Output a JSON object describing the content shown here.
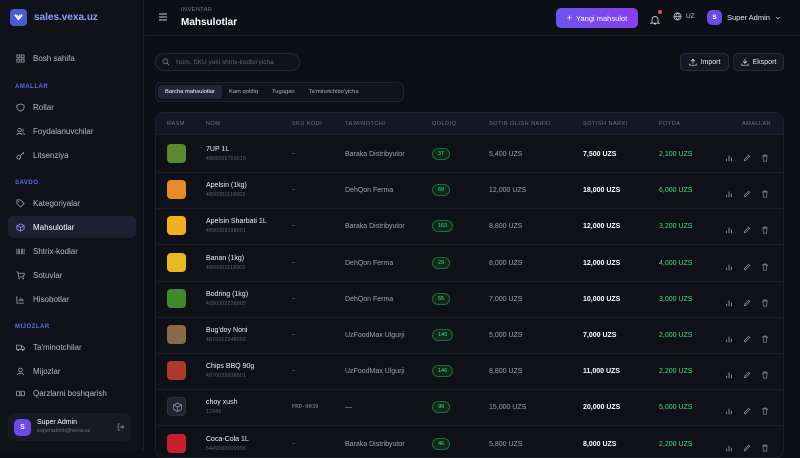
{
  "brand": {
    "name": "sales.vexa.uz"
  },
  "sidebar": {
    "items_top": [
      {
        "label": "Bosh sahifa",
        "icon": "grid-icon"
      }
    ],
    "sections": [
      {
        "title": "AMALLAR",
        "items": [
          {
            "label": "Rollar",
            "icon": "shield-icon"
          },
          {
            "label": "Foydalanuvchilar",
            "icon": "users-icon"
          },
          {
            "label": "Litsenziya",
            "icon": "key-icon"
          }
        ]
      },
      {
        "title": "SAVDO",
        "items": [
          {
            "label": "Kategoriyalar",
            "icon": "tag-icon"
          },
          {
            "label": "Mahsulotlar",
            "icon": "box-icon",
            "active": true
          },
          {
            "label": "Shtrix-kodlar",
            "icon": "barcode-icon"
          },
          {
            "label": "Sotuvlar",
            "icon": "cart-icon"
          },
          {
            "label": "Hisobotlar",
            "icon": "chart-icon"
          }
        ]
      },
      {
        "title": "MIJOZLAR",
        "items": [
          {
            "label": "Ta'minotchilar",
            "icon": "truck-icon"
          },
          {
            "label": "Mijozlar",
            "icon": "user-icon"
          },
          {
            "label": "Qarzlarni boshqarish",
            "icon": "money-icon"
          }
        ]
      }
    ],
    "user": {
      "initial": "S",
      "name": "Super Admin",
      "email": "superadmin@vexa.uz"
    }
  },
  "header": {
    "breadcrumb": "INVENTAR",
    "title": "Mahsulotlar",
    "new_button": "Yangi mahsulot",
    "lang": "UZ",
    "user_initial": "S",
    "user_name": "Super Admin"
  },
  "toolbar": {
    "search_placeholder": "Nom, SKU yoki shtrix-kodbo'yicha",
    "import_label": "Import",
    "export_label": "Eksport"
  },
  "tabs": [
    "Barcha mahsulotlar",
    "Kam qoldiq",
    "Tugagan",
    "Ta'minotchibo'yicha"
  ],
  "table": {
    "columns": [
      "RASM",
      "NOM",
      "SKU KODI",
      "TA'MINOTCHI",
      "QOLDIQ",
      "SOTIB OLISH NARXI",
      "SOTISH NARXI",
      "FOYDA",
      "AMALLAR"
    ],
    "rows": [
      {
        "name": "7UP 1L",
        "code": "4868096700015",
        "sku": "—",
        "supplier": "Baraka Distribyutor",
        "qty": "37",
        "buy": "5,400 UZS",
        "sell": "7,500 UZS",
        "profit": "2,100 UZS",
        "thumb": "#5a8a2a"
      },
      {
        "name": "Apelsin (1kg)",
        "code": "4890001118003",
        "sku": "—",
        "supplier": "DehQon Ferma",
        "qty": "69",
        "buy": "12,000 UZS",
        "sell": "18,000 UZS",
        "profit": "6,000 UZS",
        "thumb": "#e8892a"
      },
      {
        "name": "Apelsin Sharbati 1L",
        "code": "4890008298001",
        "sku": "—",
        "supplier": "Baraka Distribyutor",
        "qty": "163",
        "buy": "8,800 UZS",
        "sell": "12,000 UZS",
        "profit": "3,200 UZS",
        "thumb": "#f0b020"
      },
      {
        "name": "Banan (1kg)",
        "code": "4890001118002",
        "sku": "—",
        "supplier": "DehQon Ferma",
        "qty": "29",
        "buy": "8,000 UZS",
        "sell": "12,000 UZS",
        "profit": "4,000 UZS",
        "thumb": "#e8b820"
      },
      {
        "name": "Bodring (1kg)",
        "code": "4890002228005",
        "sku": "—",
        "supplier": "DehQon Ferma",
        "qty": "55",
        "buy": "7,000 UZS",
        "sell": "10,000 UZS",
        "profit": "3,000 UZS",
        "thumb": "#3f8a2a"
      },
      {
        "name": "Bug'doy Noni",
        "code": "4870012348002",
        "sku": "—",
        "supplier": "UzFoodMax Ulgurji",
        "qty": "146",
        "buy": "5,000 UZS",
        "sell": "7,000 UZS",
        "profit": "2,000 UZS",
        "thumb": "#8a6a4a"
      },
      {
        "name": "Chips BBQ 90g",
        "code": "4870035038001",
        "sku": "—",
        "supplier": "UzFoodMax Ulgurji",
        "qty": "146",
        "buy": "8,800 UZS",
        "sell": "11,000 UZS",
        "profit": "2,200 UZS",
        "thumb": "#b03a2a"
      },
      {
        "name": "choy xush",
        "code": "12345",
        "sku": "PRD-0039",
        "supplier": "—",
        "qty": "99",
        "buy": "15,000 UZS",
        "sell": "20,000 UZS",
        "profit": "5,000 UZS",
        "thumb": "#22252f"
      },
      {
        "name": "Coca-Cola 1L",
        "code": "5449000000996",
        "sku": "—",
        "supplier": "Baraka Distribyutor",
        "qty": "46",
        "buy": "5,800 UZS",
        "sell": "8,000 UZS",
        "profit": "2,200 UZS",
        "thumb": "#c8202a"
      }
    ]
  },
  "colors": {
    "accent": "#6a55f0",
    "profit": "#4ade80",
    "bg": "#0d0f16"
  }
}
